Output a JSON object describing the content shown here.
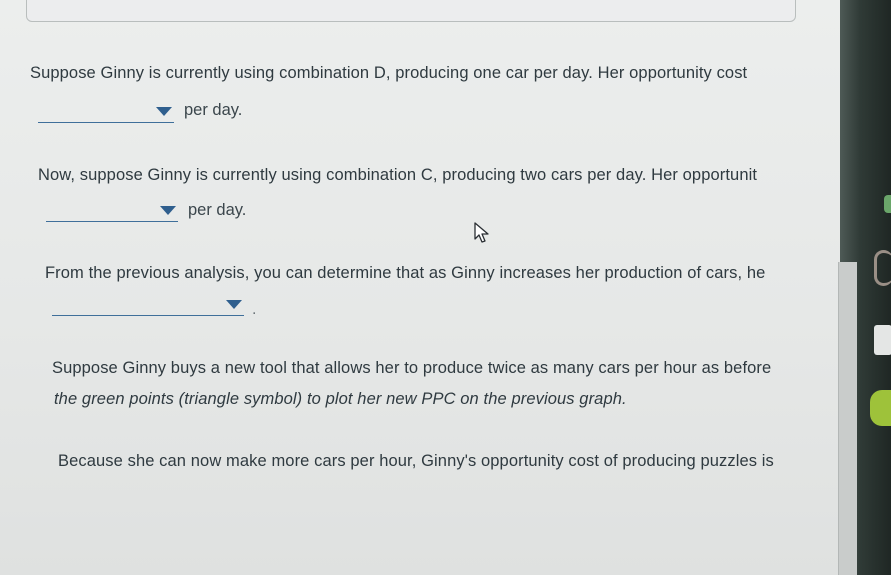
{
  "q1": {
    "text": "Suppose Ginny is currently using combination D, producing one car per day. Her opportunity cost",
    "suffix": "per day."
  },
  "q2": {
    "text": "Now, suppose Ginny is currently using combination C, producing two cars per day. Her opportunit",
    "suffix": "per day."
  },
  "q3": {
    "text": "From the previous analysis, you can determine that as Ginny increases her production of cars, he",
    "suffix": "."
  },
  "q4": {
    "line1": "Suppose Ginny buys a new tool that allows her to produce twice as many cars per hour as before",
    "line2": "the green points (triangle symbol) to plot her new PPC on the previous graph."
  },
  "q5": {
    "text": "Because she can now make more cars per hour, Ginny's opportunity cost of producing puzzles is"
  },
  "colors": {
    "accent": "#2f5f8e",
    "text": "#2f3a40",
    "background": "#e7e9e8"
  },
  "icons": {
    "dropdown": "triangle-down",
    "cursor": "mouse-pointer"
  }
}
